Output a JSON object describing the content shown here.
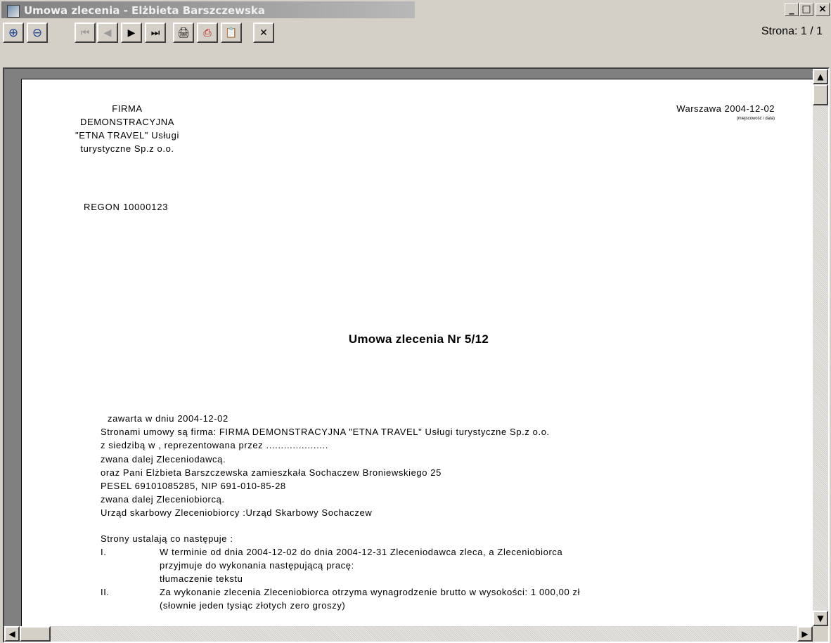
{
  "window": {
    "title": "Umowa zlecenia - Elżbieta Barszczewska",
    "minimize": "_",
    "maximize": "□",
    "close": "×"
  },
  "toolbar": {
    "buttons": [
      {
        "name": "zoom-in-button",
        "icon": "zoom-in-icon",
        "glyph": "⊕",
        "enabled": true
      },
      {
        "name": "zoom-out-button",
        "icon": "zoom-out-icon",
        "glyph": "⊖",
        "enabled": true
      },
      {
        "name": "first-page-button",
        "icon": "first-page-icon",
        "glyph": "⏮",
        "enabled": false
      },
      {
        "name": "prev-page-button",
        "icon": "prev-page-icon",
        "glyph": "◀",
        "enabled": false
      },
      {
        "name": "next-page-button",
        "icon": "next-page-icon",
        "glyph": "▶",
        "enabled": true
      },
      {
        "name": "last-page-button",
        "icon": "last-page-icon",
        "glyph": "⏭",
        "enabled": true
      },
      {
        "name": "print-button",
        "icon": "printer-icon",
        "glyph": "🖨",
        "enabled": true
      },
      {
        "name": "export-pdf-button",
        "icon": "pdf-icon",
        "glyph": "⎙",
        "enabled": true
      },
      {
        "name": "copy-button",
        "icon": "clipboard-icon",
        "glyph": "📋",
        "enabled": false
      },
      {
        "name": "close-preview-button",
        "icon": "close-icon",
        "glyph": "✕",
        "enabled": true
      }
    ],
    "page_indicator": "Strona: 1 / 1"
  },
  "document": {
    "firm_lines": [
      "FIRMA",
      "DEMONSTRACYJNA",
      "\"ETNA TRAVEL\" Usługi",
      "turystyczne Sp.z o.o."
    ],
    "city_date": "Warszawa 2004-12-02",
    "city_note": "(miejscowość i data)",
    "regon": "REGON 10000123",
    "title": "Umowa zlecenia Nr 5/12",
    "line_01": "zawarta w dniu 2004-12-02",
    "line_02": "Stronami umowy są firma: FIRMA DEMONSTRACYJNA \"ETNA TRAVEL\" Usługi turystyczne Sp.z o.o.",
    "line_03": "z siedzibą w    , reprezentowana przez .....................",
    "line_04": "zwana dalej Zleceniodawcą.",
    "line_05": "oraz Pani Elżbieta Barszczewska zamieszkała Sochaczew Broniewskiego 25",
    "line_06": "PESEL 69101085285, NIP 691-010-85-28",
    "line_07": "zwana dalej Zleceniobiorcą.",
    "line_08": "Urząd skarbowy Zleceniobiorcy :Urząd Skarbowy Sochaczew",
    "line_09": "Strony ustalają co następuje :",
    "line_10_num": "I.",
    "line_10": "W terminie od dnia 2004-12-02 do dnia 2004-12-31 Zleceniodawca zleca, a Zleceniobiorca",
    "line_11": "przyjmuje do wykonania następującą pracę:",
    "line_12": "tłumaczenie tekstu",
    "line_13_num": "II.",
    "line_13": "Za wykonanie zlecenia Zleceniobiorca otrzyma wynagrodzenie brutto w wysokości: 1 000,00 zł",
    "line_14": "(słownie jeden tysiąc złotych zero groszy)"
  },
  "scrollbars": {
    "up": "▲",
    "down": "▼",
    "left": "◀",
    "right": "▶"
  }
}
